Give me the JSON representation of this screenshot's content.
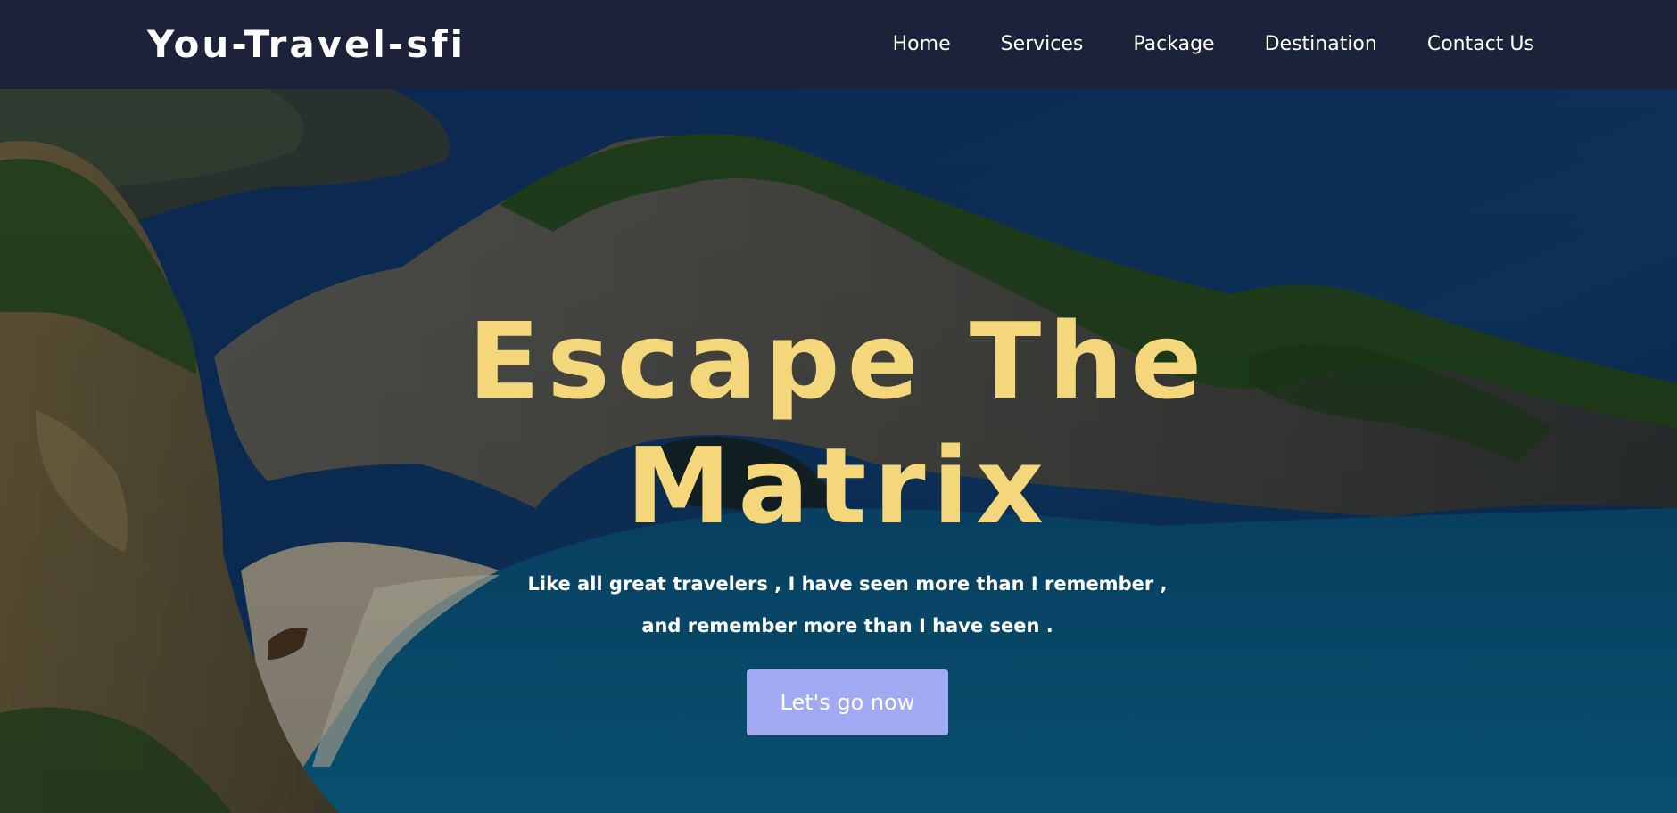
{
  "navbar": {
    "brand": "You-Travel-sfi",
    "links": [
      "Home",
      "Services",
      "Package",
      "Destination",
      "Contact Us"
    ]
  },
  "hero": {
    "title_line1": "Escape The",
    "title_line2": "Matrix",
    "subtitle_line1": "Like all great travelers , I have seen more than I remember ,",
    "subtitle_line2": "and remember more than I have seen .",
    "cta_label": "Let's go now",
    "background": "cliff-cove-sea-photo"
  },
  "colors": {
    "nav_bg": "#1b223a",
    "title": "#f4d77a",
    "cta_bg": "#a1a9f0",
    "text": "#ffffff"
  }
}
